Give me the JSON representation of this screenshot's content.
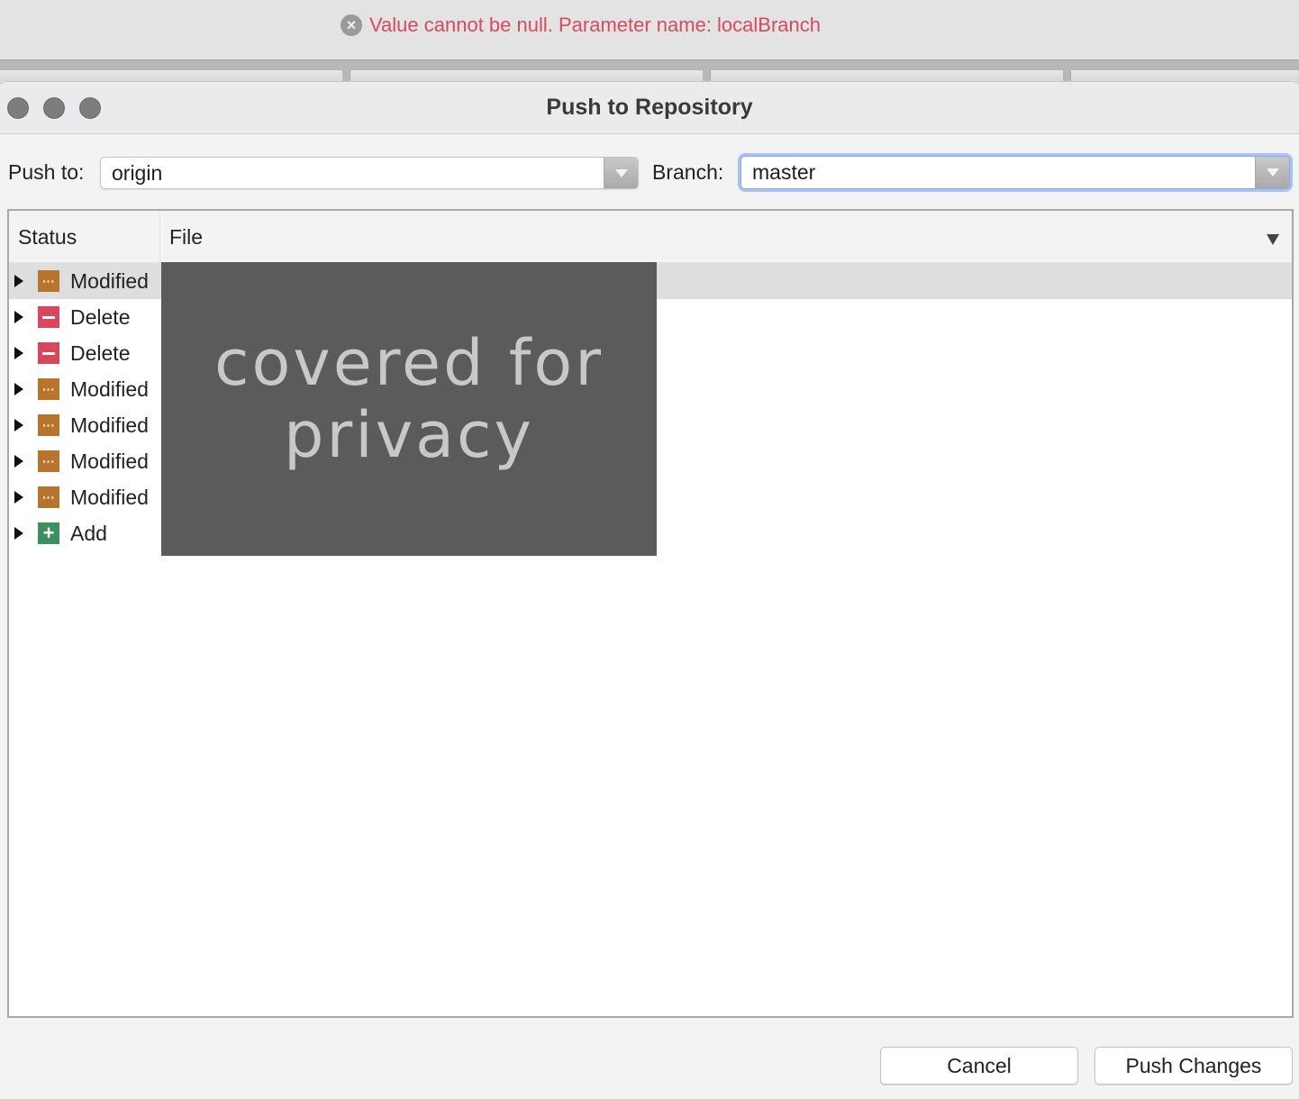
{
  "error_bar": {
    "icon": "error-circle-x-icon",
    "message": "Value cannot be null. Parameter name: localBranch",
    "color": "#d64b5b"
  },
  "dialog": {
    "title": "Push to Repository",
    "push_to": {
      "label": "Push to:",
      "value": "origin"
    },
    "branch": {
      "label": "Branch:",
      "value": "master"
    },
    "table": {
      "columns": [
        "Status",
        "File"
      ],
      "rows": [
        {
          "status": "Modified",
          "icon": "modified-icon",
          "file": ""
        },
        {
          "status": "Delete",
          "icon": "delete-icon",
          "file": ""
        },
        {
          "status": "Delete",
          "icon": "delete-icon",
          "file": ""
        },
        {
          "status": "Modified",
          "icon": "modified-icon",
          "file": ""
        },
        {
          "status": "Modified",
          "icon": "modified-icon",
          "file": ""
        },
        {
          "status": "Modified",
          "icon": "modified-icon",
          "file": ""
        },
        {
          "status": "Modified",
          "icon": "modified-icon",
          "file": ""
        },
        {
          "status": "Add",
          "icon": "add-icon",
          "file": ""
        }
      ],
      "privacy_overlay": "covered for privacy"
    },
    "buttons": {
      "cancel": "Cancel",
      "push": "Push Changes"
    }
  },
  "colors": {
    "modified": "#b8732e",
    "delete": "#d9475c",
    "add": "#3c8f5e",
    "focus_ring": "#a9c2f3"
  }
}
